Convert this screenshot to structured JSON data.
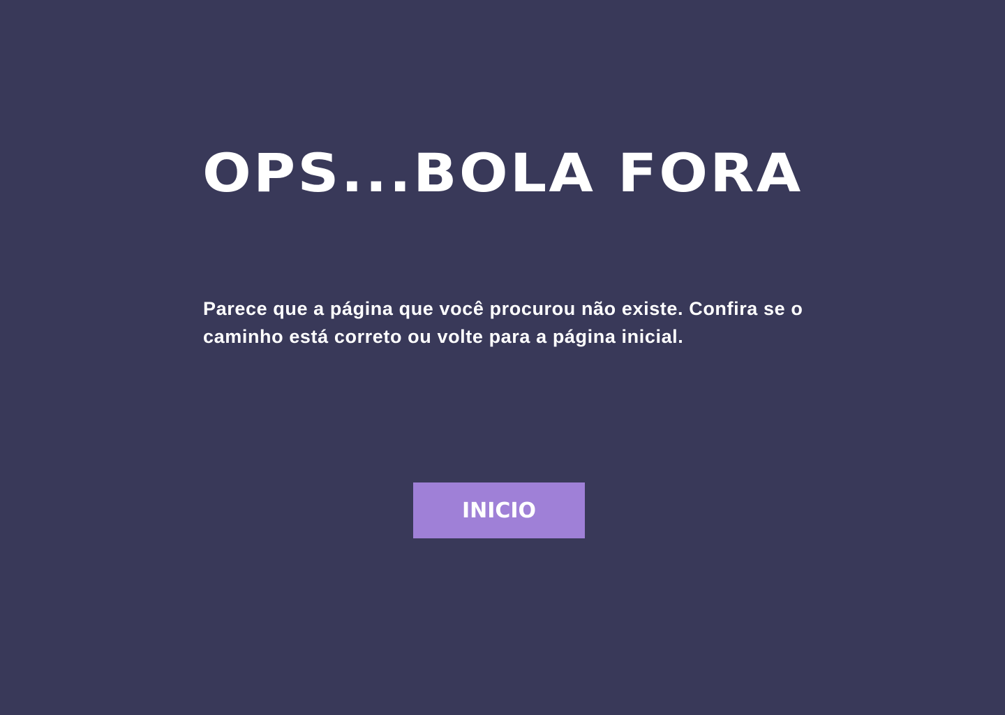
{
  "page": {
    "title": "OPS...BOLA FORA",
    "message": "Parece que a página que você procurou não existe. Confira se o caminho está correto ou volte para a página inicial.",
    "home_button_label": "INICIO"
  },
  "colors": {
    "background": "#393959",
    "text": "#ffffff",
    "button_background": "#9f80d7"
  }
}
